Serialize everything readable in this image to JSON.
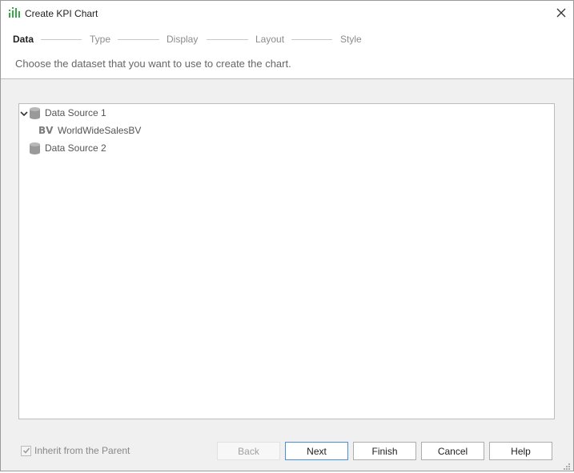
{
  "window": {
    "title": "Create KPI Chart",
    "app_icon": "chart-bars-icon",
    "close_icon": "close-icon"
  },
  "wizard": {
    "steps": [
      {
        "label": "Data",
        "active": true
      },
      {
        "label": "Type",
        "active": false
      },
      {
        "label": "Display",
        "active": false
      },
      {
        "label": "Layout",
        "active": false
      },
      {
        "label": "Style",
        "active": false
      }
    ],
    "instruction": "Choose the dataset that you want to use to create the chart."
  },
  "tree": {
    "items": [
      {
        "label": "Data Source 1",
        "icon": "database-icon",
        "expanded": true,
        "level": 0
      },
      {
        "label": "WorldWideSalesBV",
        "icon": "business-view-icon",
        "icon_text": "BV",
        "level": 1
      },
      {
        "label": "Data Source 2",
        "icon": "database-icon",
        "expanded": false,
        "level": 0
      }
    ]
  },
  "footer": {
    "inherit_label": "Inherit from the Parent",
    "inherit_checked": true,
    "buttons": {
      "back": "Back",
      "next": "Next",
      "finish": "Finish",
      "cancel": "Cancel",
      "help": "Help"
    }
  },
  "colors": {
    "accent": "#4a8fd6",
    "icon_green": "#3aa848"
  }
}
